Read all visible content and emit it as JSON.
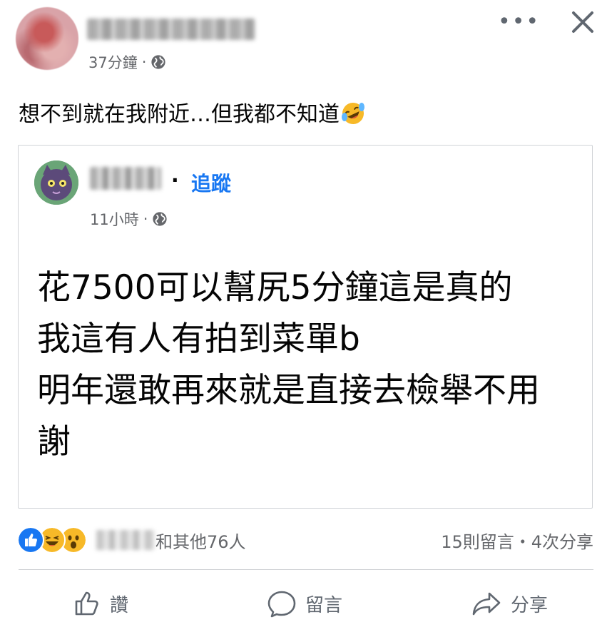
{
  "post": {
    "time": "37分鐘",
    "separator": "·",
    "text": "想不到就在我附近…但我都不知道",
    "emoji": "laughing-crying-emoji"
  },
  "shared": {
    "separator": "·",
    "follow_label": "追蹤",
    "time": "11小時",
    "text": "花7500可以幫尻5分鐘這是真的\n我這有人有拍到菜單b\n明年還敢再來就是直接去檢舉不用\n謝"
  },
  "reactions": {
    "icons": [
      "like-reaction",
      "haha-reaction",
      "wow-reaction"
    ],
    "others": "和其他76人",
    "counts": "15則留言・4次分享"
  },
  "actions": {
    "like": "讚",
    "comment": "留言",
    "share": "分享"
  },
  "colors": {
    "accent": "#1877f2",
    "secondary_text": "#65676b",
    "divider": "#ced0d4"
  }
}
